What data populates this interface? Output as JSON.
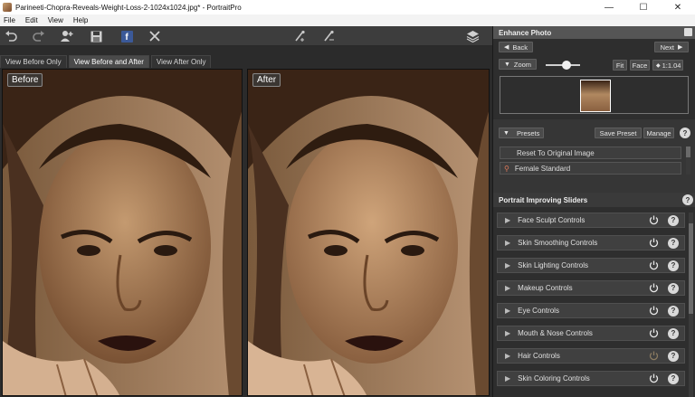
{
  "window": {
    "title": "Parineeti-Chopra-Reveals-Weight-Loss-2-1024x1024.jpg* - PortraitPro",
    "controls": [
      "—",
      "☐",
      "✕"
    ]
  },
  "menu": [
    "File",
    "Edit",
    "View",
    "Help"
  ],
  "toolbar": {
    "icons": [
      "undo-icon",
      "redo-icon",
      "add-person-icon",
      "save-icon",
      "facebook-icon",
      "close-icon",
      "brush-add-icon",
      "brush-remove-icon",
      "layers-icon"
    ],
    "facebook_glyph": "f"
  },
  "tabs": [
    "View Before Only",
    "View Before and After",
    "View After Only"
  ],
  "panes": {
    "before_label": "Before",
    "after_label": "After"
  },
  "enhance": {
    "title": "Enhance Photo",
    "back": "Back",
    "next": "Next",
    "zoom_label": "Zoom",
    "zoom_level": 0.6,
    "fit": "Fit",
    "face": "Face",
    "ratio": "1:1.04"
  },
  "presets": {
    "label": "Presets",
    "save": "Save Preset",
    "manage": "Manage",
    "items": [
      "Reset To Original Image",
      "Female Standard"
    ]
  },
  "sliders": {
    "title": "Portrait Improving Sliders",
    "items": [
      "Face Sculpt Controls",
      "Skin Smoothing Controls",
      "Skin Lighting Controls",
      "Makeup Controls",
      "Eye Controls",
      "Mouth & Nose Controls",
      "Hair Controls",
      "Skin Coloring Controls"
    ]
  },
  "colors": {
    "panel_bg": "#2e2e2e",
    "header_bg": "#555555",
    "photo_tone": "#a07850"
  }
}
